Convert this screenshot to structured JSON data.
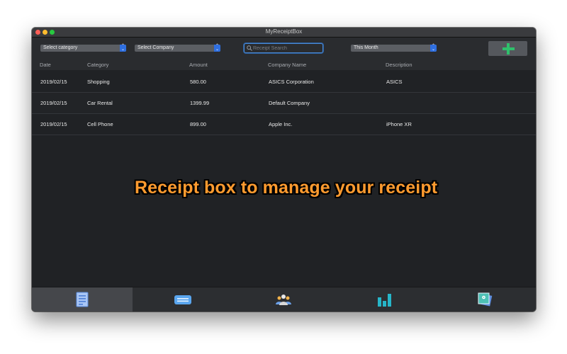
{
  "window": {
    "title": "MyReceiptBox"
  },
  "toolbar": {
    "category_select": "Select category",
    "company_select": "Select Company",
    "search_placeholder": "Receipt Search",
    "period_select": "This Month"
  },
  "table": {
    "headers": [
      "Date",
      "Category",
      "Amount",
      "Company Name",
      "Description"
    ],
    "rows": [
      [
        "2019/02/15",
        "Shopping",
        "580.00",
        "ASICS Corporation",
        "ASICS"
      ],
      [
        "2019/02/15",
        "Car Rental",
        "1399.99",
        "Default Company",
        ""
      ],
      [
        "2019/02/15",
        "Cell Phone",
        "899.00",
        "Apple Inc.",
        "iPhone XR"
      ]
    ]
  },
  "overlay": {
    "caption": "Receipt box to manage your receipt"
  },
  "tabs": [
    {
      "icon": "receipt-icon",
      "active": true
    },
    {
      "icon": "ticket-icon",
      "active": false
    },
    {
      "icon": "people-icon",
      "active": false
    },
    {
      "icon": "bar-chart-icon",
      "active": false
    },
    {
      "icon": "photo-settings-icon",
      "active": false
    }
  ],
  "colors": {
    "accent": "#2f6fe0",
    "add_green": "#2fc06b",
    "caption_orange": "#ff9b2f"
  }
}
